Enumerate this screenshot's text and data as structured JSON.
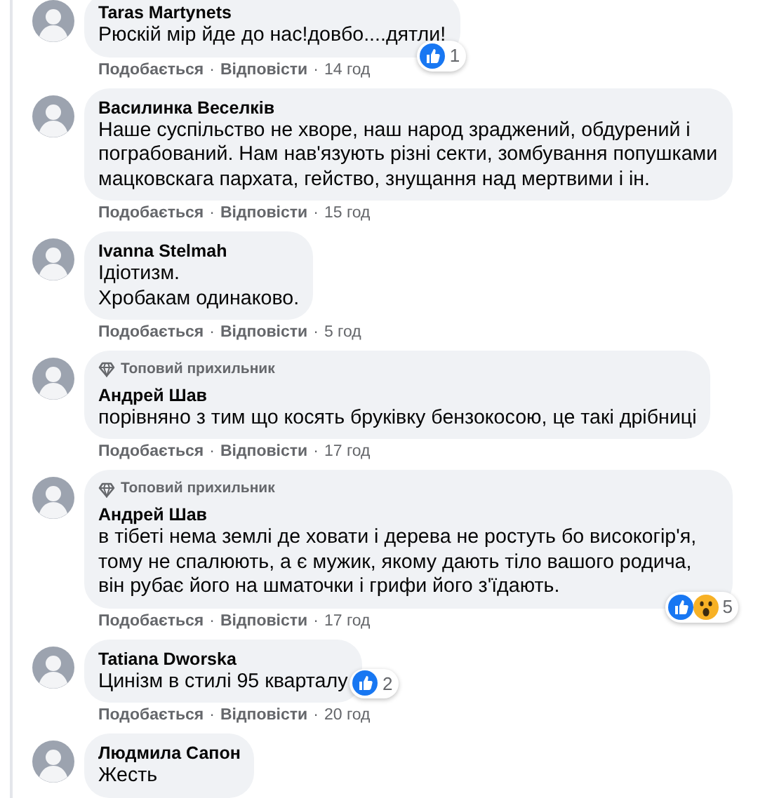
{
  "separator": "·",
  "comments": [
    {
      "author": "Taras Martynets",
      "text": [
        "Рюскій мір йде до нас!довбо....дятли!"
      ],
      "actions": [
        "Подобається",
        "Відповісти"
      ],
      "time": "14 год",
      "reactions": {
        "kind": "corner",
        "icons": [
          {
            "kind": "like"
          }
        ],
        "count": "1"
      }
    },
    {
      "author": "Василинка Веселків",
      "text": [
        "Наше суспільство не хворе, наш народ зраджений, обдурений і пограбований. Нам нав'язують різні секти, зомбування попушками мацковскага пархата, гейство, знущання над мертвими і ін."
      ],
      "actions": [
        "Подобається",
        "Відповісти"
      ],
      "time": "15 год"
    },
    {
      "author": "Ivanna Stelmah",
      "text": [
        "Ідіотизм.",
        "Хробакам одинаково."
      ],
      "actions": [
        "Подобається",
        "Відповісти"
      ],
      "time": "5 год"
    },
    {
      "badge": "Топовий прихильник",
      "author": "Андрей Шав",
      "text": [
        "порівняно з тим що косять бруківку бензокосою, це такі дрібниці"
      ],
      "actions": [
        "Подобається",
        "Відповісти"
      ],
      "time": "17 год"
    },
    {
      "badge": "Топовий прихильник",
      "author": "Андрей Шав",
      "text": [
        "в тібеті нема землі де ховати і дерева не ростуть бо високогір'я, тому не спалюють, а є мужик, якому дають тіло вашого родича, він рубає його на шматочки і грифи його з'їдають."
      ],
      "actions": [
        "Подобається",
        "Відповісти"
      ],
      "time": "17 год",
      "reactions": {
        "kind": "corner",
        "icons": [
          {
            "kind": "like"
          },
          {
            "kind": "wow"
          }
        ],
        "count": "5"
      }
    },
    {
      "author": "Tatiana Dworska",
      "text": [
        "Цинізм в стилі 95 кварталу"
      ],
      "actions": [
        "Подобається",
        "Відповісти"
      ],
      "time": "20 год",
      "reactions": {
        "kind": "side",
        "icons": [
          {
            "kind": "like"
          }
        ],
        "count": "2"
      }
    },
    {
      "author": "Людмила Сапон",
      "text": [
        "Жесть"
      ]
    }
  ]
}
